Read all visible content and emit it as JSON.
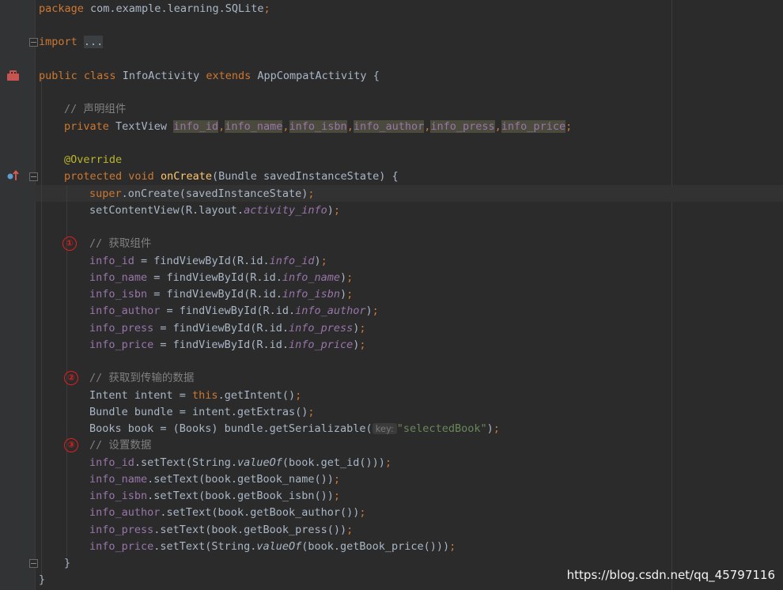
{
  "lines": {
    "package": {
      "kw": "package",
      "name": " com.example.learning.SQLite",
      "semi": ";"
    },
    "import": {
      "kw": "import",
      "sp": " ",
      "folded": "..."
    },
    "class_decl": {
      "mod": "public",
      "cls": "class",
      "name": " InfoActivity ",
      "ext": "extends",
      "parent": " AppCompatActivity {"
    },
    "comment_decl": "// 声明组件",
    "field_decl": {
      "mod": "private",
      "type": " TextView ",
      "f1": "info_id",
      "f2": "info_name",
      "f3": "info_isbn",
      "f4": "info_author",
      "f5": "info_press",
      "f6": "info_price",
      "comma": ",",
      "semi": ";"
    },
    "override": "@Override",
    "oncreate": {
      "mod": "protected",
      "ret": "void",
      "name": "onCreate",
      "params": "(Bundle savedInstanceState) {"
    },
    "super_call": {
      "kw": "super",
      "rest": ".onCreate(savedInstanceState)",
      "semi": ";"
    },
    "set_content": {
      "pre": "setContentView(R.layout.",
      "res": "activity_info",
      "post": ")",
      "semi": ";"
    },
    "comment_get": "// 获取组件",
    "find": [
      {
        "field": "info_id",
        "mid": " = findViewById(R.id.",
        "res": "info_id",
        "post": ")",
        "semi": ";"
      },
      {
        "field": "info_name",
        "mid": " = findViewById(R.id.",
        "res": "info_name",
        "post": ")",
        "semi": ";"
      },
      {
        "field": "info_isbn",
        "mid": " = findViewById(R.id.",
        "res": "info_isbn",
        "post": ")",
        "semi": ";"
      },
      {
        "field": "info_author",
        "mid": " = findViewById(R.id.",
        "res": "info_author",
        "post": ")",
        "semi": ";"
      },
      {
        "field": "info_press",
        "mid": " = findViewById(R.id.",
        "res": "info_press",
        "post": ")",
        "semi": ";"
      },
      {
        "field": "info_price",
        "mid": " = findViewById(R.id.",
        "res": "info_price",
        "post": ")",
        "semi": ";"
      }
    ],
    "comment_transfer": "// 获取到传输的数据",
    "intent": {
      "pre": "Intent intent = ",
      "kw": "this",
      "post": ".getIntent()",
      "semi": ";"
    },
    "bundle": {
      "text": "Bundle bundle = intent.getExtras()",
      "semi": ";"
    },
    "books": {
      "pre": "Books book = (Books) bundle.getSerializable(",
      "hint": "key:",
      "str": "\"selectedBook\"",
      "post": ")",
      "semi": ";"
    },
    "comment_set": "// 设置数据",
    "settext": [
      {
        "field": "info_id",
        "pre": ".setText(String.",
        "it": "valueOf",
        "post": "(book.get_id()))",
        "semi": ";"
      },
      {
        "field": "info_name",
        "pre": ".setText(book.getBook_name())",
        "it": "",
        "post": "",
        "semi": ";"
      },
      {
        "field": "info_isbn",
        "pre": ".setText(book.getBook_isbn())",
        "it": "",
        "post": "",
        "semi": ";"
      },
      {
        "field": "info_author",
        "pre": ".setText(book.getBook_author())",
        "it": "",
        "post": "",
        "semi": ";"
      },
      {
        "field": "info_press",
        "pre": ".setText(book.getBook_press())",
        "it": "",
        "post": "",
        "semi": ";"
      },
      {
        "field": "info_price",
        "pre": ".setText(String.",
        "it": "valueOf",
        "post": "(book.getBook_price()))",
        "semi": ";"
      }
    ],
    "close_method": "}",
    "close_class": "}"
  },
  "markers": [
    "①",
    "②",
    "③"
  ],
  "gutter_icons": {
    "class_icon": "android-class-icon",
    "override_icon": "override-up-arrow-icon"
  },
  "watermark": "https://blog.csdn.net/qq_45797116",
  "colors": {
    "background": "#2b2b2b",
    "keyword": "#cc7832",
    "comment": "#808080",
    "field": "#9876aa",
    "method": "#ffc66d",
    "annotation": "#bbb529",
    "string": "#6a8759",
    "text": "#a9b7c6",
    "marker": "#e02020"
  }
}
